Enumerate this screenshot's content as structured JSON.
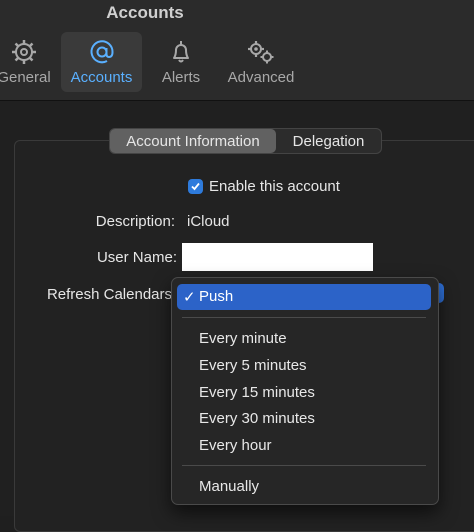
{
  "window": {
    "title": "Accounts"
  },
  "toolbar": {
    "tabs": [
      {
        "label": "General",
        "icon": "gear-icon"
      },
      {
        "label": "Accounts",
        "icon": "at-sign-icon"
      },
      {
        "label": "Alerts",
        "icon": "bell-icon"
      },
      {
        "label": "Advanced",
        "icon": "gears-icon"
      }
    ],
    "active_tab": "Accounts",
    "accent_color": "#5ab0ff"
  },
  "segmented": {
    "items": [
      "Account Information",
      "Delegation"
    ],
    "selected": "Account Information"
  },
  "form": {
    "enable_label": "Enable this account",
    "enable_checked": true,
    "description_label": "Description:",
    "description_value": "iCloud",
    "username_label": "User Name:",
    "username_value": "",
    "refresh_label": "Refresh Calendars"
  },
  "refresh_menu": {
    "selected": "Push",
    "check_mark": "✓",
    "options": [
      "Every minute",
      "Every 5 minutes",
      "Every 15 minutes",
      "Every 30 minutes",
      "Every hour"
    ],
    "manual": "Manually",
    "highlight_color": "#2c63c8"
  }
}
